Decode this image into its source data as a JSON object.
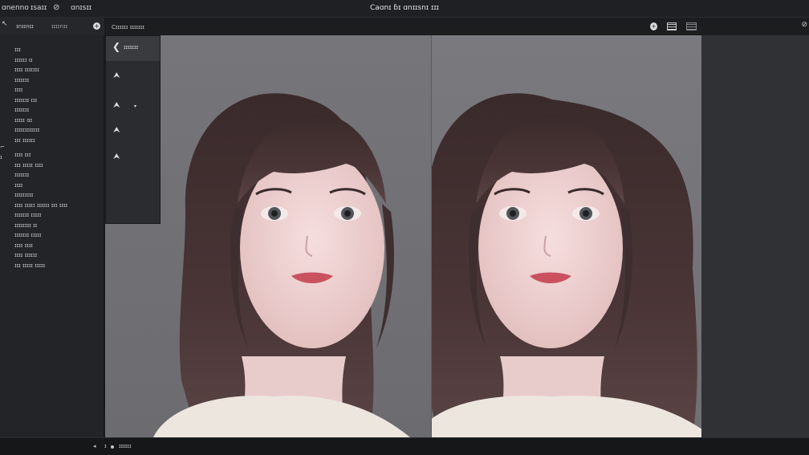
{
  "menubar": {
    "items": [
      "ɑnenno",
      "ɪsaɪɪ",
      "⊘",
      "ɑnɪsɪɪ"
    ],
    "window_title": "Caɑnɪ ɓɪ ɑnɪɪsnɪ ɪɪɪ"
  },
  "sidebar": {
    "back_icon": "↖",
    "tabs": [
      "ɪnɪɪnɪɪ",
      "ɪɪɪɪnɪɪ"
    ],
    "add_icon": "+",
    "marks": [
      "⌐",
      "ɪ"
    ],
    "items": [
      "ɪɪɪ",
      "ɪɪɪɪɪɪ ɑ",
      "ɪɪɪɪ ɪɪɪɪɪɪɪ",
      "ɪɪɪɪɪɪɪ",
      "ɪɪɪɪ",
      "ɪɪɪɪɪɪɪ ɪɪɪ",
      "ɪɪɪɪɪɪɪ",
      "ɪɪɪɪɪ ɑɪ",
      "ɪɪɪɪɪɪɪɪɪɪɪɪ",
      "ɪɪɪ ɪɪɪɪɪɪ",
      "ɪɪɪɪ ɪɪɪ",
      "ɪɪɪ ɪɪɪɪɪ ɪɪɪɪ",
      "ɪɪɪɪɪɪɪ",
      "ɪɪɪɪ",
      "ɪɪɪɪɪɪɪɪɪ",
      "ɪɪɪɪ ɪɪɪɪɪ ɪɪɪɪɪɪ ɪɪɪ ɪɪɪɪ",
      "ɪɪɪɪɪɪɪ ɪɪɪɪɪ",
      "ɪɪɪɪɪɪɪɪ ɪɪ",
      "ɪɪɪɪɪɪɪ ɪɪɪɪɪ",
      "ɪɪɪɪ ɪɪɪɪ",
      "ɪɪɪɪ ɪɪɪɪɪɪ",
      "ɪɪɪ ɪɪɪɪɪ ɪɪɪɪɪ"
    ]
  },
  "toolbar": {
    "label": "Cɪɪɪɪɪɪ ɪɪɪɪɪɪɪ",
    "dot_icon": "+",
    "right_icon": "⊘"
  },
  "toolpanel": {
    "back_arrow": "❮",
    "label": "ɪɪɪɪɪɪɪ",
    "tools": [
      "⮝",
      "⮝",
      "⮝",
      "⮝"
    ],
    "caret": "▾"
  },
  "statusbar": {
    "items": [
      "◂",
      "ɪ",
      "ɪɪɪɪɪɪ"
    ]
  }
}
